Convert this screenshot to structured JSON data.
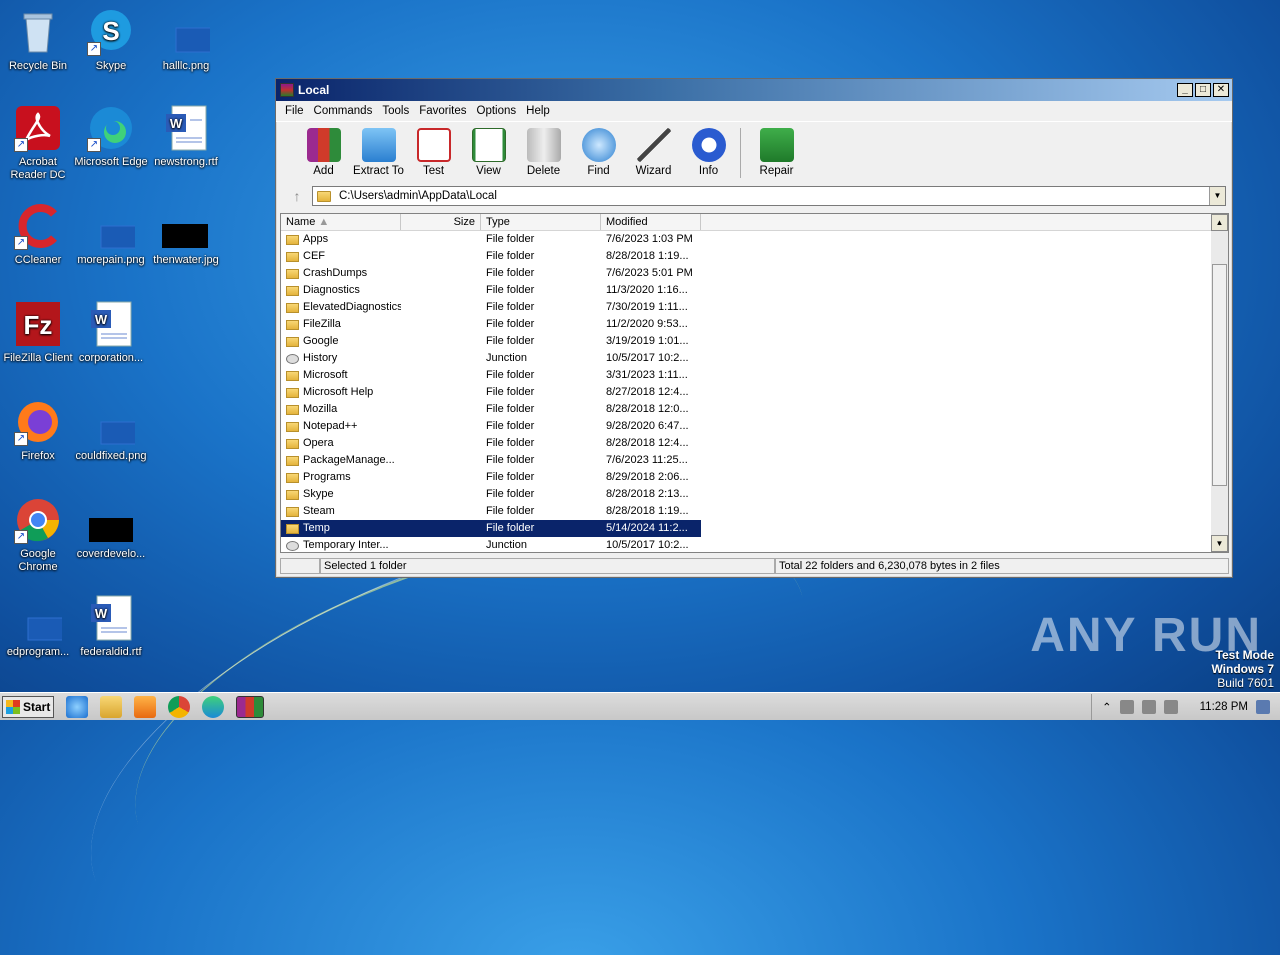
{
  "desktop": {
    "icons": [
      {
        "label": "Recycle Bin"
      },
      {
        "label": "Skype"
      },
      {
        "label": "halllc.png"
      },
      {
        "label": "Acrobat Reader DC"
      },
      {
        "label": "Microsoft Edge"
      },
      {
        "label": "newstrong.rtf"
      },
      {
        "label": "CCleaner"
      },
      {
        "label": "morepain.png"
      },
      {
        "label": "thenwater.jpg"
      },
      {
        "label": "FileZilla Client"
      },
      {
        "label": "corporation..."
      },
      {
        "label": "Firefox"
      },
      {
        "label": "couldfixed.png"
      },
      {
        "label": "Google Chrome"
      },
      {
        "label": "coverdevelo..."
      },
      {
        "label": "edprogram..."
      },
      {
        "label": "federaldid.rtf"
      }
    ]
  },
  "window": {
    "title": "Local",
    "menu": [
      "File",
      "Commands",
      "Tools",
      "Favorites",
      "Options",
      "Help"
    ],
    "toolbar": [
      "Add",
      "Extract To",
      "Test",
      "View",
      "Delete",
      "Find",
      "Wizard",
      "Info",
      "Repair"
    ],
    "address": "C:\\Users\\admin\\AppData\\Local",
    "columns": {
      "name": "Name",
      "size": "Size",
      "type": "Type",
      "modified": "Modified"
    },
    "rows": [
      {
        "name": "Apps",
        "type": "File folder",
        "modified": "7/6/2023 1:03 PM"
      },
      {
        "name": "CEF",
        "type": "File folder",
        "modified": "8/28/2018 1:19..."
      },
      {
        "name": "CrashDumps",
        "type": "File folder",
        "modified": "7/6/2023 5:01 PM"
      },
      {
        "name": "Diagnostics",
        "type": "File folder",
        "modified": "11/3/2020 1:16..."
      },
      {
        "name": "ElevatedDiagnostics",
        "type": "File folder",
        "modified": "7/30/2019 1:11..."
      },
      {
        "name": "FileZilla",
        "type": "File folder",
        "modified": "11/2/2020 9:53..."
      },
      {
        "name": "Google",
        "type": "File folder",
        "modified": "3/19/2019 1:01..."
      },
      {
        "name": "History",
        "type": "Junction",
        "modified": "10/5/2017 10:2..."
      },
      {
        "name": "Microsoft",
        "type": "File folder",
        "modified": "3/31/2023 1:11..."
      },
      {
        "name": "Microsoft Help",
        "type": "File folder",
        "modified": "8/27/2018 12:4..."
      },
      {
        "name": "Mozilla",
        "type": "File folder",
        "modified": "8/28/2018 12:0..."
      },
      {
        "name": "Notepad++",
        "type": "File folder",
        "modified": "9/28/2020 6:47..."
      },
      {
        "name": "Opera",
        "type": "File folder",
        "modified": "8/28/2018 12:4..."
      },
      {
        "name": "PackageManage...",
        "type": "File folder",
        "modified": "7/6/2023 11:25..."
      },
      {
        "name": "Programs",
        "type": "File folder",
        "modified": "8/29/2018 2:06..."
      },
      {
        "name": "Skype",
        "type": "File folder",
        "modified": "8/28/2018 2:13..."
      },
      {
        "name": "Steam",
        "type": "File folder",
        "modified": "8/28/2018 1:19..."
      },
      {
        "name": "Temp",
        "type": "File folder",
        "modified": "5/14/2024 11:2...",
        "selected": true
      },
      {
        "name": "Temporary Inter...",
        "type": "Junction",
        "modified": "10/5/2017 10:2..."
      }
    ],
    "status_left": "Selected 1 folder",
    "status_right": "Total 22 folders and 6,230,078 bytes in 2 files"
  },
  "taskbar": {
    "start_label": "Start",
    "clock": "11:28 PM"
  },
  "watermark": "ANY RUN",
  "test_mode": {
    "line1": "Test Mode",
    "line2": "Windows 7",
    "line3": "Build 7601"
  }
}
